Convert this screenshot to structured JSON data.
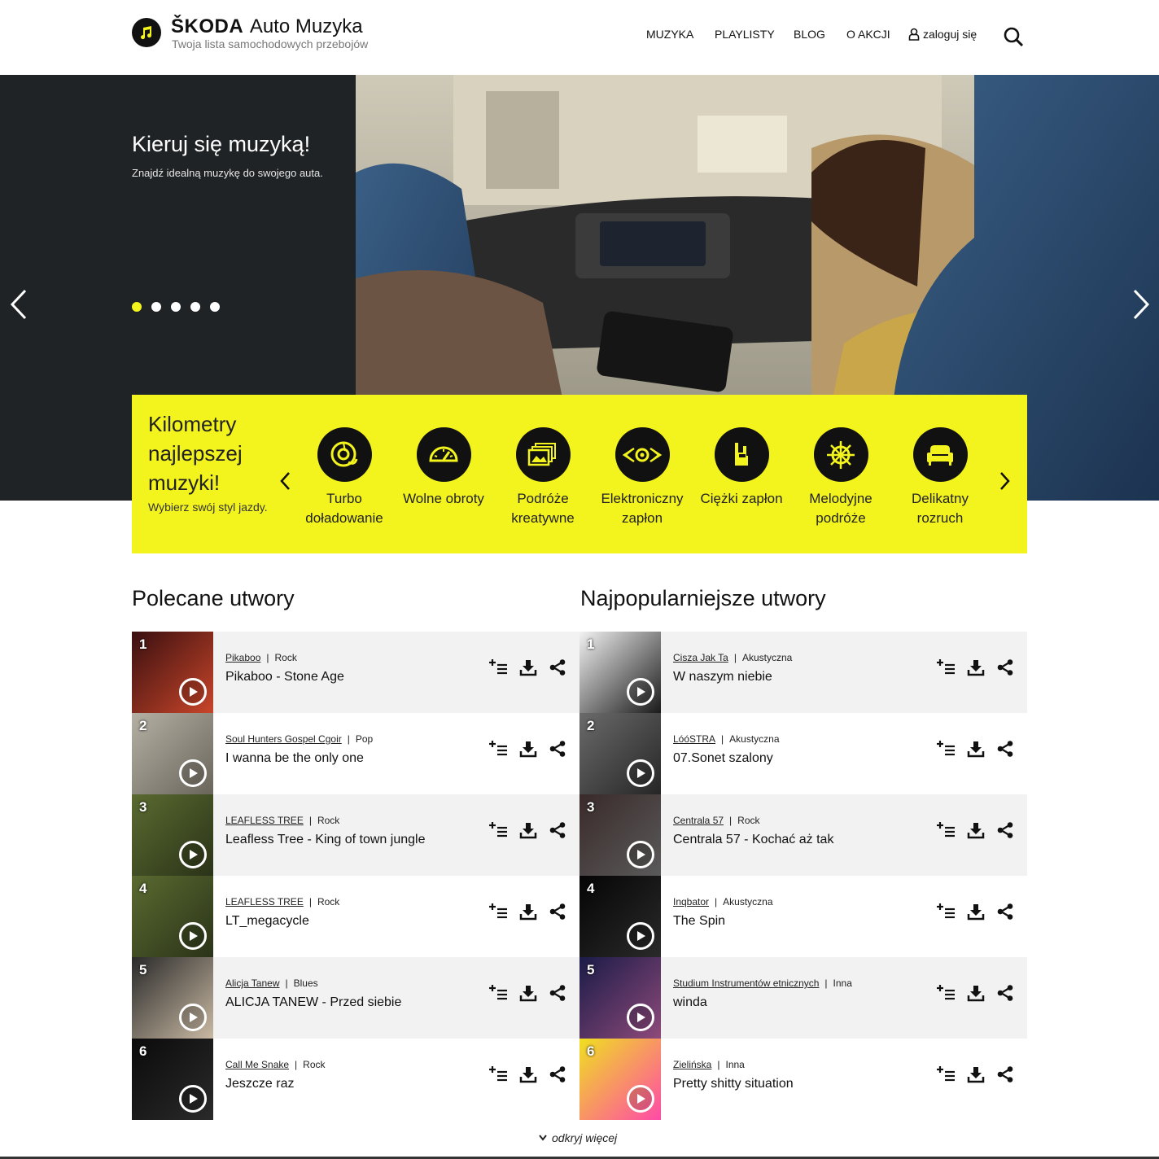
{
  "header": {
    "brand_bold": "ŠKODA",
    "brand_rest": "Auto Muzyka",
    "tagline": "Twoja lista samochodowych przebojów",
    "nav": [
      "MUZYKA",
      "PLAYLISTY",
      "BLOG",
      "O AKCJI"
    ],
    "login": "zaloguj się"
  },
  "hero": {
    "title": "Kieruj się muzyką!",
    "subtitle": "Znajdź idealną muzykę do swojego auta.",
    "slide_count": 5,
    "active_slide": 1
  },
  "styles": {
    "title": "Kilometry najlepszej muzyki!",
    "subtitle": "Wybierz swój styl jazdy.",
    "items": [
      {
        "label": "Turbo doładowanie",
        "icon": "turbo-icon"
      },
      {
        "label": "Wolne obroty",
        "icon": "speedometer-icon"
      },
      {
        "label": "Podróże kreatywne",
        "icon": "photos-icon"
      },
      {
        "label": "Elektroniczny zapłon",
        "icon": "speaker-wave-icon"
      },
      {
        "label": "Ciężki zapłon",
        "icon": "rock-hand-icon"
      },
      {
        "label": "Melodyjne podróże",
        "icon": "ship-wheel-icon"
      },
      {
        "label": "Delikatny rozruch",
        "icon": "sofa-icon"
      }
    ]
  },
  "recommended": {
    "title": "Polecane utwory",
    "tracks": [
      {
        "rank": "1",
        "artist": "Pikaboo",
        "genre": "Rock",
        "title": "Pikaboo - Stone Age"
      },
      {
        "rank": "2",
        "artist": "Soul Hunters Gospel Cgoir",
        "genre": "Pop",
        "title": "I wanna be the only one"
      },
      {
        "rank": "3",
        "artist": "LEAFLESS TREE",
        "genre": "Rock",
        "title": "Leafless Tree - King of town jungle"
      },
      {
        "rank": "4",
        "artist": "LEAFLESS TREE",
        "genre": "Rock",
        "title": "LT_megacycle"
      },
      {
        "rank": "5",
        "artist": "Alicja Tanew",
        "genre": "Blues",
        "title": "ALICJA TANEW - Przed siebie"
      },
      {
        "rank": "6",
        "artist": "Call Me Snake",
        "genre": "Rock",
        "title": "Jeszcze raz"
      }
    ]
  },
  "popular": {
    "title": "Najpopularniejsze utwory",
    "tracks": [
      {
        "rank": "1",
        "artist": "Cisza Jak Ta",
        "genre": "Akustyczna",
        "title": "W naszym niebie"
      },
      {
        "rank": "2",
        "artist": "LóóSTRA",
        "genre": "Akustyczna",
        "title": "07.Sonet szalony"
      },
      {
        "rank": "3",
        "artist": "Centrala 57",
        "genre": "Rock",
        "title": "Centrala 57 - Kochać aż tak"
      },
      {
        "rank": "4",
        "artist": "Inqbator",
        "genre": "Akustyczna",
        "title": "The Spin"
      },
      {
        "rank": "5",
        "artist": "Studium Instrumentów etnicznych",
        "genre": "Inna",
        "title": "winda"
      },
      {
        "rank": "6",
        "artist": "Zielińska",
        "genre": "Inna",
        "title": "Pretty shitty situation"
      }
    ]
  },
  "more_label": "odkryj więcej",
  "colors": {
    "accent": "#f3f31d",
    "dark": "#202326",
    "row_alt": "#f2f2f2"
  }
}
